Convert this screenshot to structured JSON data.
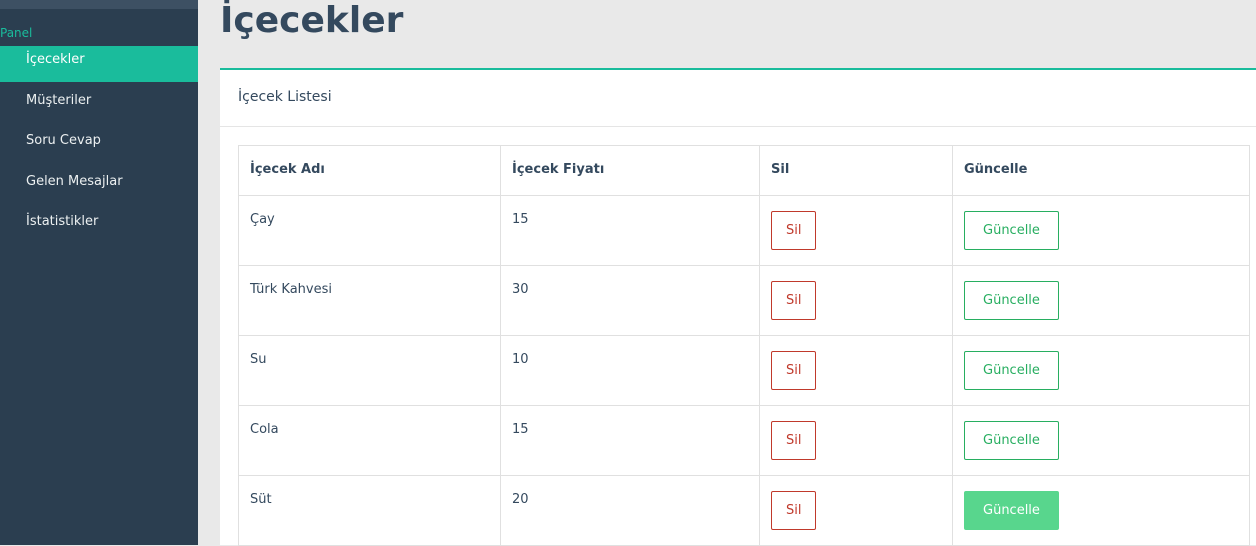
{
  "sidebar": {
    "section_label": "Panel",
    "items": [
      {
        "label": "İçecekler",
        "active": true
      },
      {
        "label": "Müşteriler",
        "active": false
      },
      {
        "label": "Soru Cevap",
        "active": false
      },
      {
        "label": "Gelen Mesajlar",
        "active": false
      },
      {
        "label": "İstatistikler",
        "active": false
      }
    ]
  },
  "page": {
    "title": "İçecekler"
  },
  "panel": {
    "heading": "İçecek Listesi"
  },
  "table": {
    "columns": [
      "İçecek Adı",
      "İçecek Fiyatı",
      "Sil",
      "Güncelle"
    ],
    "rows": [
      {
        "name": "Çay",
        "price": "15",
        "delete_label": "Sil",
        "update_label": "Güncelle"
      },
      {
        "name": "Türk Kahvesi",
        "price": "30",
        "delete_label": "Sil",
        "update_label": "Güncelle"
      },
      {
        "name": "Su",
        "price": "10",
        "delete_label": "Sil",
        "update_label": "Güncelle"
      },
      {
        "name": "Cola",
        "price": "15",
        "delete_label": "Sil",
        "update_label": "Güncelle"
      },
      {
        "name": "Süt",
        "price": "20",
        "delete_label": "Sil",
        "update_label": "Güncelle"
      }
    ]
  },
  "colors": {
    "sidebar_bg": "#2b3e50",
    "accent": "#1abc9c",
    "delete": "#c0392b",
    "update": "#27ae60",
    "update_hover": "#58d68d"
  }
}
